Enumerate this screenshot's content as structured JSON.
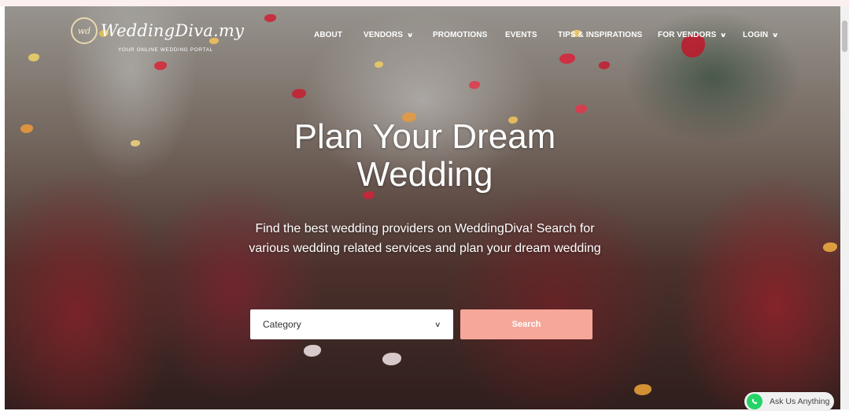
{
  "brand": {
    "logo_mark": "wd",
    "name": "WeddingDiva.my",
    "tagline": "YOUR ONLINE WEDDING PORTAL"
  },
  "nav": [
    {
      "label": "ABOUT",
      "has_dropdown": false
    },
    {
      "label": "VENDORS",
      "has_dropdown": true
    },
    {
      "label": "PROMOTIONS",
      "has_dropdown": false
    },
    {
      "label": "EVENTS",
      "has_dropdown": false
    },
    {
      "label": "TIPS & INSPIRATIONS",
      "has_dropdown": false
    },
    {
      "label": "FOR VENDORS",
      "has_dropdown": true
    },
    {
      "label": "LOGIN",
      "has_dropdown": true
    }
  ],
  "hero": {
    "headline_line1": "Plan Your Dream",
    "headline_line2": "Wedding",
    "sub_line1": "Find the best wedding providers on WeddingDiva! Search for",
    "sub_line2": "various wedding related services and plan your dream wedding"
  },
  "search": {
    "category_value": "Category",
    "button_label": "Search"
  },
  "whatsapp": {
    "label": "Ask Us Anything"
  },
  "colors": {
    "accent": "#f6a79a",
    "whatsapp": "#25d366"
  }
}
